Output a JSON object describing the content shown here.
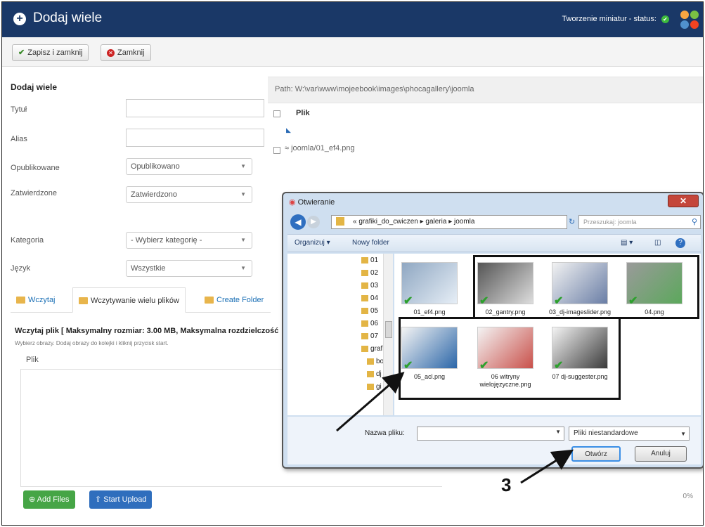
{
  "header": {
    "title": "Dodaj wiele",
    "status": "Tworzenie miniatur - status:"
  },
  "toolbar": {
    "save_close": "Zapisz i zamknij",
    "close": "Zamknij"
  },
  "form": {
    "title": "Dodaj wiele",
    "fields": {
      "title": "Tytuł",
      "alias": "Alias",
      "published": "Opublikowane",
      "published_value": "Opublikowano",
      "approved": "Zatwierdzone",
      "approved_value": "Zatwierdzono",
      "category": "Kategoria",
      "category_value": "- Wybierz kategorię -",
      "language": "Język",
      "language_value": "Wszystkie"
    }
  },
  "files": {
    "path": "Path: W:\\var\\www\\mojeebook\\images\\phocagallery\\joomla",
    "header": "Plik",
    "row": "joomla/01_ef4.png"
  },
  "tabs": [
    "Wczytaj",
    "Wczytywanie wielu plików",
    "Create Folder"
  ],
  "upload": {
    "title": "Wczytaj plik [ Maksymalny rozmiar: 3.00 MB, Maksymalna rozdzielczość",
    "subtitle": "Wybierz obrazy. Dodaj obrazy do kolejki i kliknij przycisk start.",
    "list_label": "Plik",
    "add": "Add Files",
    "start": "Start Upload",
    "percent": "0%"
  },
  "dialog": {
    "title": "Otwieranie",
    "breadcrumb": "«  grafiki_do_cwiczen  ▸  galeria  ▸  joomla",
    "search_placeholder": "Przeszukaj: joomla",
    "organize": "Organizuj ▾",
    "new_folder": "Nowy folder",
    "tree": [
      "01",
      "02",
      "03",
      "04",
      "05",
      "06",
      "07",
      "graf",
      "bo",
      "dj",
      "gi"
    ],
    "files": [
      "01_ef4.png",
      "02_gantry.png",
      "03_dj-imageslider.png",
      "04.png",
      "05_acl.png",
      "06 witryny wielojęzyczne.png",
      "07 dj-suggester.png"
    ],
    "file_name_label": "Nazwa pliku:",
    "file_type": "Pliki niestandardowe",
    "open": "Otwórz",
    "cancel": "Anuluj"
  },
  "callout": "3"
}
